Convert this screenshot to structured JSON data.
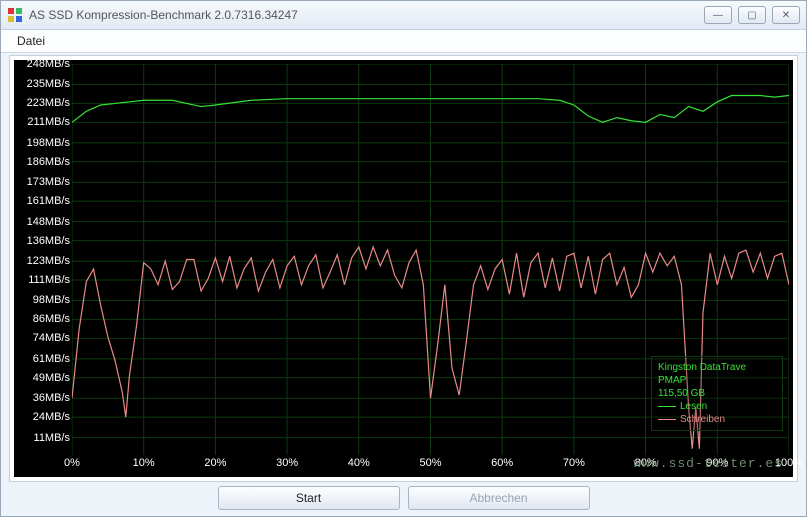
{
  "window": {
    "title": "AS SSD Kompression-Benchmark 2.0.7316.34247"
  },
  "menu": {
    "datei": "Datei"
  },
  "buttons": {
    "start": "Start",
    "abbrechen": "Abbrechen"
  },
  "legend": {
    "device_line1": "Kingston DataTrave",
    "device_line2": "PMAP",
    "capacity": "115,50 GB",
    "read": "Lesen",
    "write": "Schreiben"
  },
  "watermark": "www.ssd-tester.es",
  "chart_data": {
    "type": "line",
    "xlabel": "",
    "ylabel": "",
    "x_unit": "%",
    "y_unit": "MB/s",
    "xlim": [
      0,
      100
    ],
    "ylim": [
      0,
      248
    ],
    "x_ticks": [
      0,
      10,
      20,
      30,
      40,
      50,
      60,
      70,
      80,
      90,
      100
    ],
    "y_ticks": [
      11,
      24,
      36,
      49,
      61,
      74,
      86,
      98,
      111,
      123,
      136,
      148,
      161,
      173,
      186,
      198,
      211,
      223,
      235,
      248
    ],
    "series": [
      {
        "name": "Lesen",
        "color": "#36e236",
        "x": [
          0,
          2,
          4,
          6,
          8,
          10,
          12,
          14,
          16,
          18,
          20,
          25,
          30,
          35,
          40,
          45,
          50,
          55,
          60,
          65,
          68,
          70,
          72,
          74,
          76,
          78,
          80,
          82,
          84,
          86,
          88,
          90,
          92,
          94,
          96,
          98,
          100
        ],
        "y": [
          211,
          218,
          222,
          223,
          224,
          225,
          225,
          225,
          223,
          221,
          222,
          225,
          226,
          226,
          226,
          226,
          226,
          226,
          226,
          226,
          225,
          222,
          215,
          211,
          214,
          212,
          211,
          216,
          214,
          221,
          218,
          224,
          228,
          228,
          228,
          227,
          228
        ]
      },
      {
        "name": "Schreiben",
        "color": "#e88a8a",
        "x": [
          0,
          1,
          2,
          3,
          4,
          5,
          6,
          7,
          7.5,
          8,
          9,
          10,
          11,
          12,
          13,
          14,
          15,
          16,
          17,
          18,
          19,
          20,
          21,
          22,
          23,
          24,
          25,
          26,
          27,
          28,
          29,
          30,
          31,
          32,
          33,
          34,
          35,
          36,
          37,
          38,
          39,
          40,
          41,
          42,
          43,
          44,
          45,
          46,
          47,
          48,
          49,
          50,
          51,
          52,
          53,
          54,
          55,
          56,
          57,
          58,
          59,
          60,
          61,
          62,
          63,
          64,
          65,
          66,
          67,
          68,
          69,
          70,
          71,
          72,
          73,
          74,
          75,
          76,
          77,
          78,
          79,
          80,
          81,
          82,
          83,
          84,
          85,
          86,
          86.5,
          87,
          87.5,
          88,
          89,
          90,
          91,
          92,
          93,
          94,
          95,
          96,
          97,
          98,
          99,
          100
        ],
        "y": [
          36,
          80,
          110,
          118,
          95,
          75,
          60,
          40,
          24,
          50,
          82,
          122,
          118,
          108,
          123,
          105,
          110,
          124,
          124,
          104,
          112,
          125,
          110,
          126,
          106,
          118,
          125,
          104,
          116,
          124,
          106,
          120,
          126,
          108,
          120,
          127,
          106,
          116,
          127,
          108,
          125,
          132,
          118,
          132,
          120,
          130,
          114,
          106,
          122,
          130,
          108,
          36,
          70,
          108,
          55,
          38,
          72,
          108,
          120,
          105,
          118,
          124,
          102,
          128,
          100,
          122,
          128,
          106,
          125,
          104,
          126,
          128,
          106,
          126,
          102,
          124,
          128,
          108,
          119,
          100,
          108,
          128,
          116,
          128,
          120,
          126,
          108,
          30,
          4,
          30,
          4,
          90,
          128,
          108,
          126,
          112,
          128,
          130,
          116,
          128,
          112,
          126,
          128,
          108
        ]
      }
    ]
  }
}
